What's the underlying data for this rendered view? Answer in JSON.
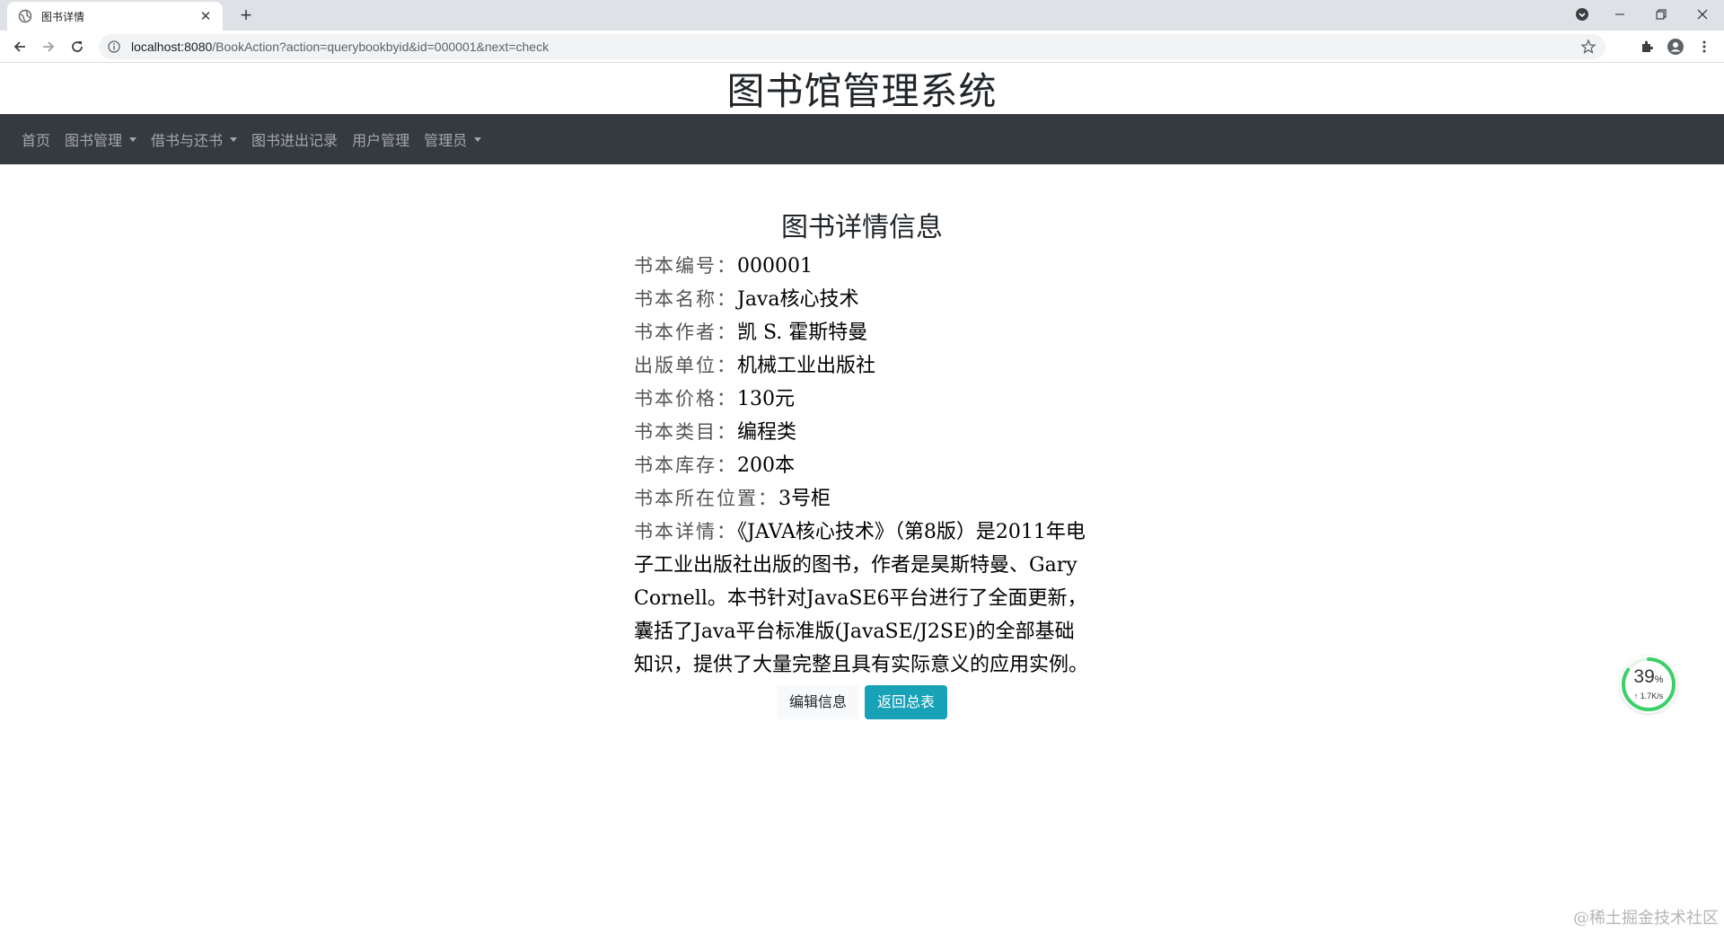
{
  "browser": {
    "tab_title": "图书详情",
    "url_host": "localhost:8080",
    "url_path": "/BookAction?action=querybookbyid&id=000001&next=check"
  },
  "site": {
    "title": "图书馆管理系统",
    "nav": [
      {
        "label": "首页",
        "dropdown": false
      },
      {
        "label": "图书管理",
        "dropdown": true
      },
      {
        "label": "借书与还书",
        "dropdown": true
      },
      {
        "label": "图书进出记录",
        "dropdown": false
      },
      {
        "label": "用户管理",
        "dropdown": false
      },
      {
        "label": "管理员",
        "dropdown": true
      }
    ]
  },
  "detail": {
    "heading": "图书详情信息",
    "fields": [
      {
        "label": "书本编号：",
        "value": "000001"
      },
      {
        "label": "书本名称：",
        "value": "Java核心技术"
      },
      {
        "label": "书本作者：",
        "value": "凯 S. 霍斯特曼"
      },
      {
        "label": "出版单位：",
        "value": "机械工业出版社"
      },
      {
        "label": "书本价格：",
        "value": "130元"
      },
      {
        "label": "书本类目：",
        "value": "编程类"
      },
      {
        "label": "书本库存：",
        "value": "200本"
      },
      {
        "label": "书本所在位置：",
        "value": "3号柜"
      }
    ],
    "description_label": "书本详情：",
    "description": "《JAVA核心技术》（第8版）是2011年电子工业出版社出版的图书，作者是昊斯特曼、Gary Cornell。本书针对JavaSE6平台进行了全面更新，囊括了Java平台标准版(JavaSE/J2SE)的全部基础知识，提供了大量完整且具有实际意义的应用实例。",
    "edit_button": "编辑信息",
    "back_button": "返回总表"
  },
  "speed_widget": {
    "percent": "39",
    "percent_unit": "%",
    "rate": "↑ 1.7K/s"
  },
  "watermark": "@稀土掘金技术社区",
  "colors": {
    "navbar": "#343a40",
    "info_button": "#17a2b8",
    "light_button": "#f8f9fa"
  }
}
